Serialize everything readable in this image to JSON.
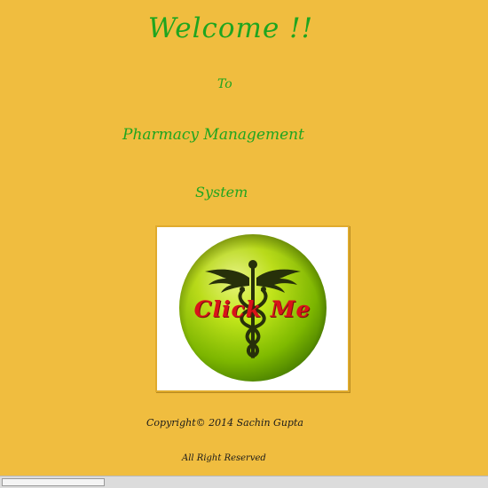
{
  "header": {
    "welcome": "Welcome !!",
    "to": "To",
    "app_name": "Pharmacy Management",
    "app_name_2": "System"
  },
  "logo": {
    "button_label": "Click Me",
    "icon": "caduceus-icon",
    "colors": {
      "globe": "#a8d400",
      "label": "#d9141a"
    }
  },
  "footer": {
    "copyright": "Copyright© 2014 Sachin Gupta",
    "rights": "All Right Reserved"
  },
  "colors": {
    "background": "#f0bd3f",
    "heading": "#1fa51f"
  }
}
